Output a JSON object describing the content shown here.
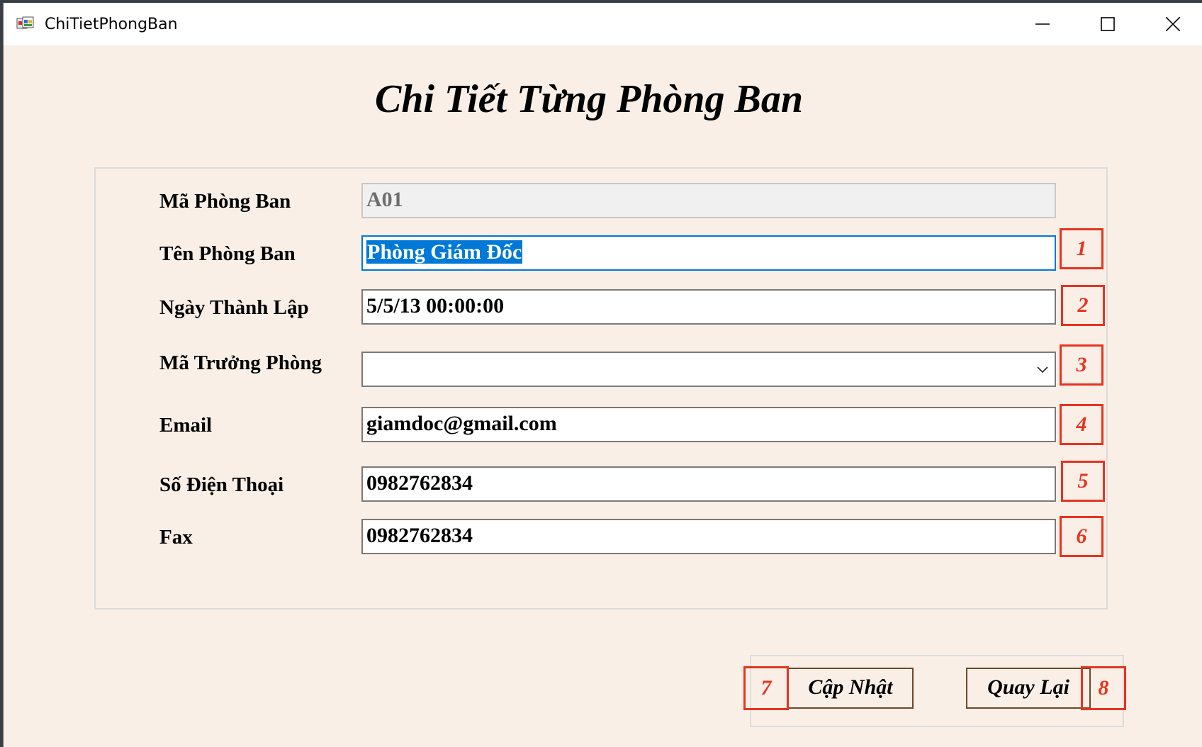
{
  "window": {
    "title": "ChiTietPhongBan"
  },
  "form": {
    "heading": "Chi Tiết Từng Phòng Ban",
    "fields": [
      {
        "label": "Mã Phòng Ban",
        "value": "A01"
      },
      {
        "label": "Tên Phòng Ban",
        "value": "Phòng Giám Đốc"
      },
      {
        "label": "Ngày Thành Lập",
        "value": "5/5/13 00:00:00"
      },
      {
        "label": "Mã Trưởng Phòng",
        "value": ""
      },
      {
        "label": "Email",
        "value": "giamdoc@gmail.com"
      },
      {
        "label": "Số Điện Thoại",
        "value": "0982762834"
      },
      {
        "label": "Fax",
        "value": "0982762834"
      }
    ]
  },
  "badges": [
    "1",
    "2",
    "3",
    "4",
    "5",
    "6",
    "7",
    "8"
  ],
  "buttons": {
    "update": "Cập Nhật",
    "back": "Quay Lại"
  },
  "colors": {
    "background": "#faefe6",
    "badge": "#e8331f",
    "focus": "#0078d7"
  }
}
